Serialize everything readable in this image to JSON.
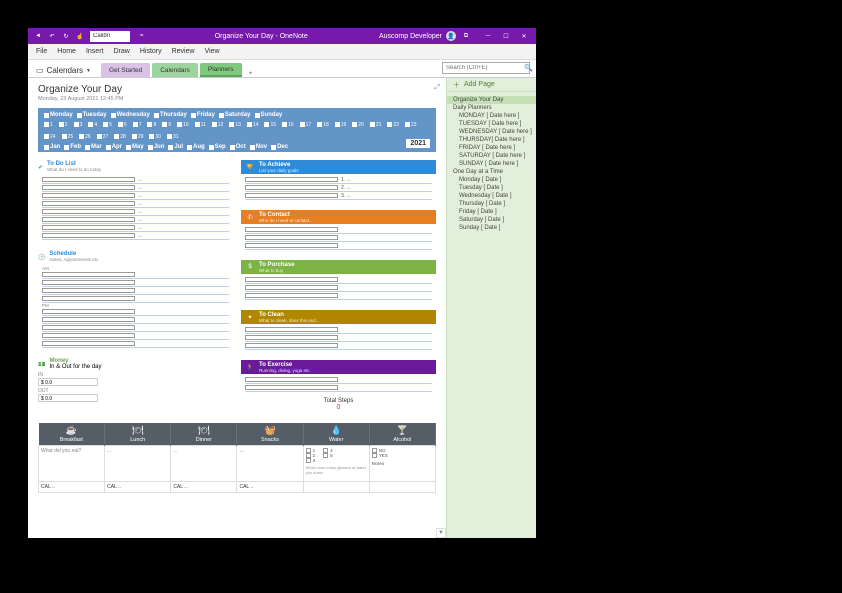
{
  "titlebar": {
    "font": "Calibri",
    "title": "Organize Your Day - OneNote",
    "user": "Auscomp Developer"
  },
  "menu": [
    "File",
    "Home",
    "Insert",
    "Draw",
    "History",
    "Review",
    "View"
  ],
  "notebook": {
    "name": "Calendars"
  },
  "tabs": [
    "Get Started",
    "Calendars",
    "Planners"
  ],
  "search": {
    "placeholder": "Search (Ctrl+E)"
  },
  "page": {
    "title": "Organize Your Day",
    "date": "Monday, 23 August 2021    12:45 PM"
  },
  "dategrid": {
    "days": [
      "Monday",
      "Tuesday",
      "Wednesday",
      "Thursday",
      "Friday",
      "Saturday",
      "Sunday"
    ],
    "months": [
      "Jan",
      "Feb",
      "Mar",
      "Apr",
      "May",
      "Jun",
      "Jul",
      "Aug",
      "Sep",
      "Oct",
      "Nov",
      "Dec"
    ],
    "year": "2021"
  },
  "todo": {
    "title": "To Do List",
    "sub": "What do I need to do today"
  },
  "achieve": {
    "title": "To Achieve",
    "sub": "List your daily goals"
  },
  "contact": {
    "title": "To Contact",
    "sub": "Who do I need to contact..."
  },
  "purchase": {
    "title": "To Purchase",
    "sub": "What to buy"
  },
  "clean": {
    "title": "To Clean",
    "sub": "What to clean, does this end..."
  },
  "exercise": {
    "title": "To Exercise",
    "sub": "Running, diving, yoga etc."
  },
  "schedule": {
    "title": "Schedule",
    "sub": "Notes, Appointments etc."
  },
  "money": {
    "title": "Money",
    "sub": "In & Out for the day",
    "in_label": "IN",
    "in_val": "$ 0.0",
    "out_label": "OUT",
    "out_val": "$ 0.0"
  },
  "steps": {
    "label": "Total Steps",
    "value": "0"
  },
  "meals": {
    "cols": [
      "Breakfast",
      "Lunch",
      "Dinner",
      "Snacks",
      "Water",
      "Alcohol"
    ],
    "hint": "What did you eat?",
    "cal": "CAL",
    "water_opts": [
      "NO",
      "YES"
    ],
    "notes_label": "Notes",
    "water_hint": "Which how many glasses of water you drank"
  },
  "rpanel": {
    "add": "Add Page",
    "pages": [
      {
        "t": "Organize Your Day",
        "l": 0,
        "a": true
      },
      {
        "t": "Daily Planners",
        "l": 0
      },
      {
        "t": "MONDAY [ Date here ]",
        "l": 1
      },
      {
        "t": "TUESDAY [ Date here ]",
        "l": 1
      },
      {
        "t": "WEDNESDAY [ Date here ]",
        "l": 1
      },
      {
        "t": "THURSDAY[ Date here ]",
        "l": 1
      },
      {
        "t": "FRIDAY [ Date here ]",
        "l": 1
      },
      {
        "t": "SATURDAY [ Date here ]",
        "l": 1
      },
      {
        "t": "SUNDAY [ Date here ]",
        "l": 1
      },
      {
        "t": "One Day at a Time",
        "l": 0
      },
      {
        "t": "Monday [ Date ]",
        "l": 1
      },
      {
        "t": "Tuesday [ Date ]",
        "l": 1
      },
      {
        "t": "Wednesday [ Date ]",
        "l": 1
      },
      {
        "t": "Thursday [ Date ]",
        "l": 1
      },
      {
        "t": "Friday [ Date ]",
        "l": 1
      },
      {
        "t": "Saturday [ Date ]",
        "l": 1
      },
      {
        "t": "Sunday [ Date ]",
        "l": 1
      }
    ]
  }
}
